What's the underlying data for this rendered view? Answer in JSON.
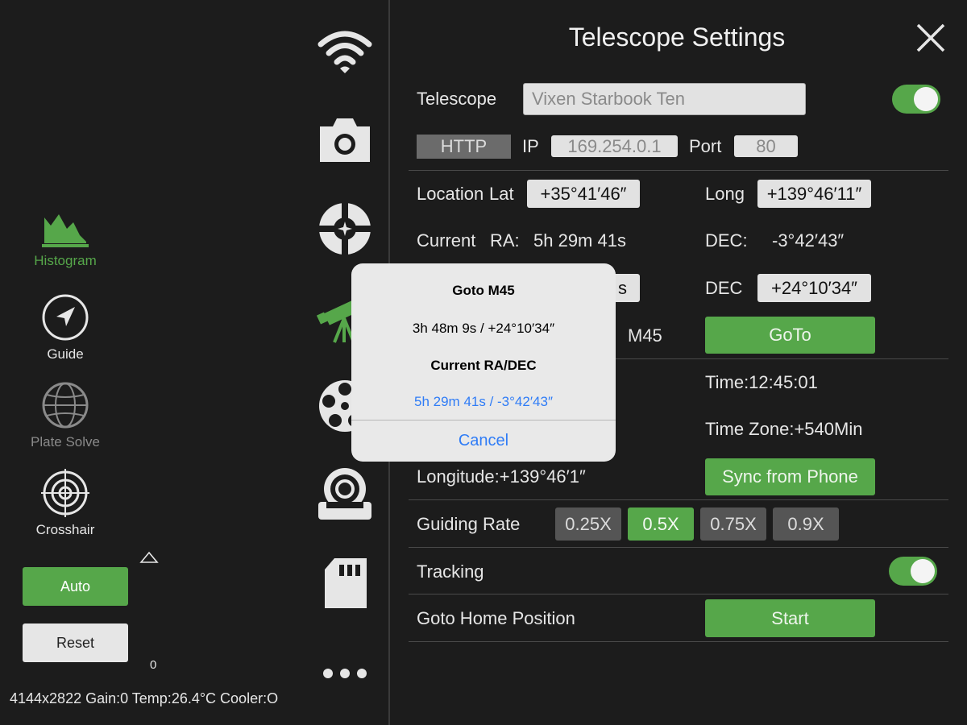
{
  "left": {
    "tools": [
      {
        "label": "Histogram"
      },
      {
        "label": "Guide"
      },
      {
        "label": "Plate Solve"
      },
      {
        "label": "Crosshair"
      }
    ],
    "auto_label": "Auto",
    "reset_label": "Reset",
    "zero_value": "0",
    "status_text": "4144x2822   Gain:0   Temp:26.4°C   Cooler:O"
  },
  "rail": {
    "icons": [
      "wifi-icon",
      "camera-icon",
      "crosshair-target-icon",
      "telescope-icon",
      "filter-wheel-icon",
      "focuser-icon",
      "sd-card-icon",
      "more-icon"
    ]
  },
  "settings": {
    "title": "Telescope Settings",
    "telescope_label": "Telescope",
    "telescope_value": "Vixen Starbook Ten",
    "protocol_label": "HTTP",
    "ip_label": "IP",
    "ip_value": "169.254.0.1",
    "port_label": "Port",
    "port_value": "80",
    "location_label": "Location",
    "lat_label": "Lat",
    "lat_value": "+35°41′46″",
    "long_label": "Long",
    "long_value": "+139°46′11″",
    "current_label": "Current",
    "ra_label": "RA:",
    "ra_value": "5h 29m 41s",
    "dec_label": "DEC:",
    "dec_value": "-3°42′43″",
    "target_ra_suffix": "s",
    "target_dec_label": "DEC",
    "target_dec_value": "+24°10′34″",
    "target_name": "M45",
    "goto_label": "GoTo",
    "time_text": "Time:12:45:01",
    "timezone_text": "Time Zone:+540Min",
    "longitude_text": "Longitude:+139°46′1″",
    "sync_label": "Sync from Phone",
    "guiding_label": "Guiding Rate",
    "guiding_rates": [
      "0.25X",
      "0.5X",
      "0.75X",
      "0.9X"
    ],
    "tracking_label": "Tracking",
    "home_label": "Goto Home Position",
    "start_label": "Start"
  },
  "alert": {
    "title": "Goto M45",
    "target_coords": "3h 48m 9s / +24°10′34″",
    "current_title": "Current RA/DEC",
    "current_coords": "5h 29m 41s / -3°42′43″",
    "cancel_label": "Cancel"
  },
  "colors": {
    "accent_green": "#56a74a",
    "background": "#1c1c1c",
    "alert_blue": "#2f7cf6"
  }
}
